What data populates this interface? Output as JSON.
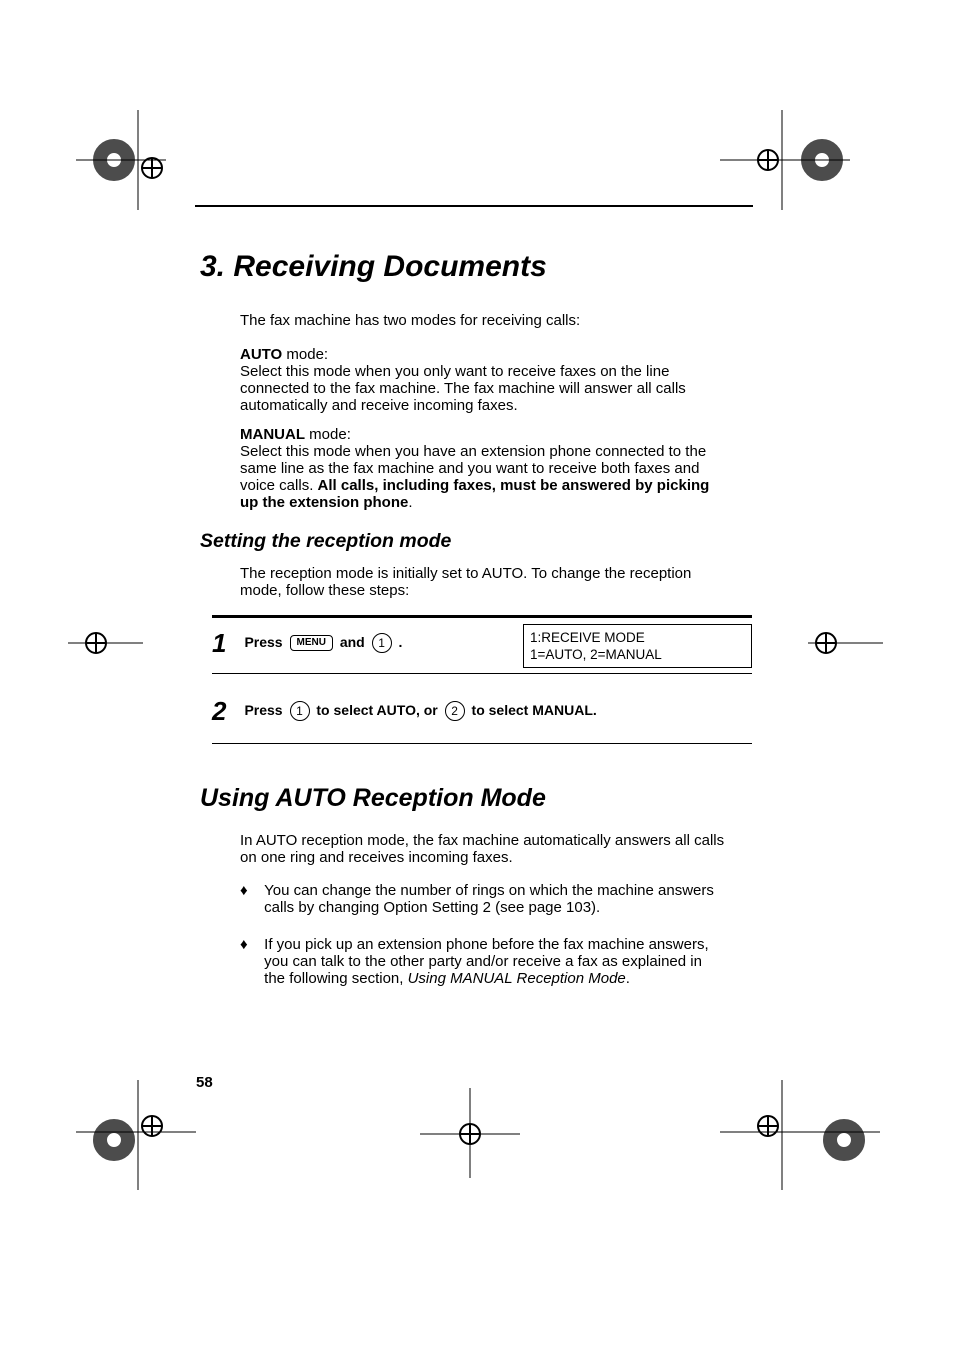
{
  "chapter_title": "3.  Receiving Documents",
  "intro": "The fax machine has two modes for receiving calls:",
  "auto_label": "AUTO",
  "mode_suffix": " mode:",
  "auto_body": "Select this mode when you only want to receive faxes on the line connected to the fax machine. The fax machine will answer all calls automatically and receive incoming faxes.",
  "manual_label": "MANUAL",
  "manual_body_lead": "Select this mode when you have an extension phone connected to the same line as the fax machine and you want to receive both faxes and voice calls. ",
  "manual_body_bold": "All calls, including faxes, must be answered by picking up the extension phone",
  "manual_body_tail": ".",
  "subheading": "Setting the reception mode",
  "sub_intro": "The reception mode is initially set to AUTO. To change the reception mode, follow these steps:",
  "step1_num": "1",
  "step1_press": "Press ",
  "menu_key": "MENU",
  "step1_and": " and ",
  "key_1": "1",
  "step1_dot": " .",
  "lcd_line1": "1:RECEIVE MODE",
  "lcd_line2": "1=AUTO, 2=MANUAL",
  "step2_num": "2",
  "step2_press": "Press ",
  "step2_mid": " to select AUTO, or ",
  "key_2": "2",
  "step2_end": " to select MANUAL.",
  "section_head": "Using AUTO Reception Mode",
  "auto_intro": "In AUTO reception mode, the fax machine automatically answers all calls on one ring and receives incoming faxes.",
  "bullet1": "You can change the number of rings on which the machine answers calls by changing Option Setting 2 (see page 103).",
  "bullet2_lead": "If you pick up an extension phone before the fax machine answers, you can talk to the other party and/or receive a fax as explained in the following section, ",
  "bullet2_italic": "Using MANUAL Reception Mode",
  "bullet2_tail": ".",
  "page_num": "58"
}
